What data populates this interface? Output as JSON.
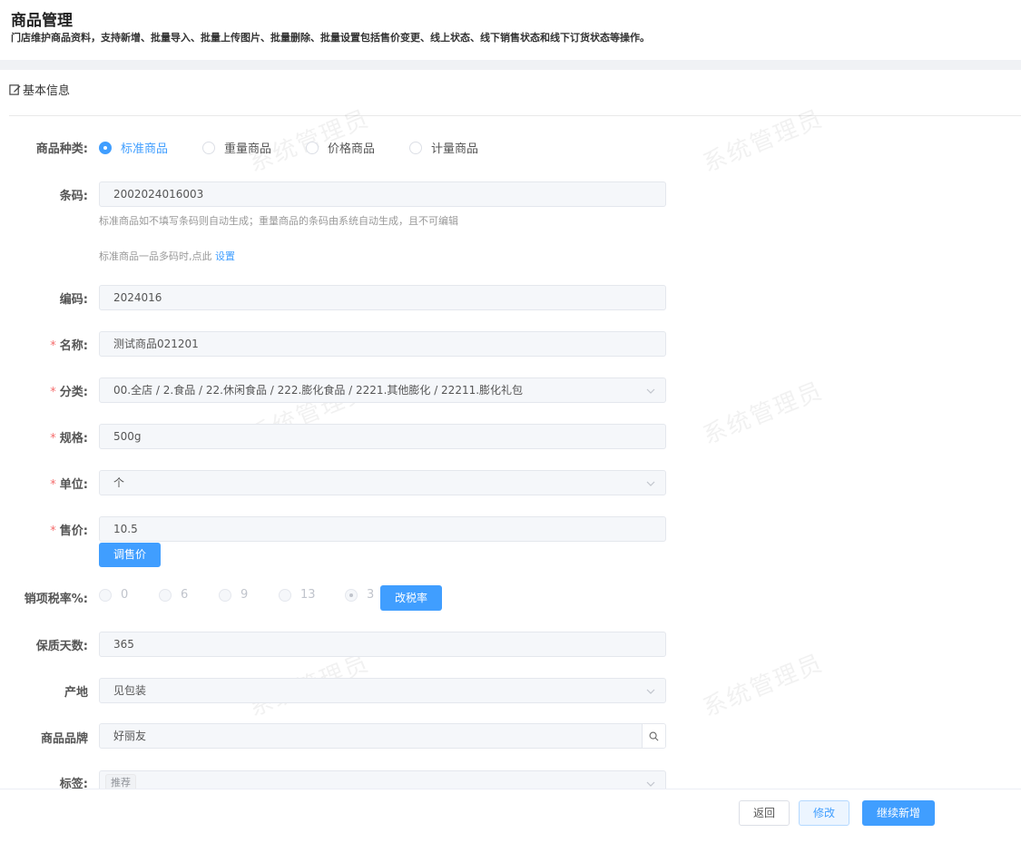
{
  "header": {
    "title": "商品管理",
    "description": "门店维护商品资料，支持新增、批量导入、批量上传图片、批量删除、批量设置包括售价变更、线上状态、线下销售状态和线下订货状态等操作。"
  },
  "section_title": "基本信息",
  "watermark": "系统管理员",
  "form": {
    "product_type": {
      "label": "商品种类:",
      "options": [
        "标准商品",
        "重量商品",
        "价格商品",
        "计量商品"
      ],
      "selected": "标准商品"
    },
    "barcode": {
      "label": "条码:",
      "value": "2002024016003",
      "hint1": "标准商品如不填写条码则自动生成；重量商品的条码由系统自动生成，且不可编辑",
      "hint2": "标准商品一品多码时,点此",
      "hint2_link": "设置"
    },
    "code": {
      "label": "编码:",
      "value": "2024016"
    },
    "name": {
      "label": "名称:",
      "value": "测试商品021201",
      "required": true
    },
    "category": {
      "label": "分类:",
      "value": "00.全店 / 2.食品 / 22.休闲食品 / 222.膨化食品 / 2221.其他膨化 / 22211.膨化礼包",
      "required": true
    },
    "spec": {
      "label": "规格:",
      "value": "500g",
      "required": true
    },
    "unit": {
      "label": "单位:",
      "value": "个",
      "required": true
    },
    "price": {
      "label": "售价:",
      "value": "10.5",
      "required": true,
      "adjust_button": "调售价"
    },
    "tax_rate": {
      "label": "销项税率%:",
      "options": [
        "0",
        "6",
        "9",
        "13",
        "3"
      ],
      "selected": "3",
      "change_button": "改税率"
    },
    "shelf_life": {
      "label": "保质天数:",
      "value": "365"
    },
    "origin": {
      "label": "产地",
      "value": "见包装"
    },
    "brand": {
      "label": "商品品牌",
      "value": "好丽友"
    },
    "tags": {
      "label": "标签:",
      "values": [
        "推荐"
      ]
    }
  },
  "footer": {
    "back_label": "返回",
    "edit_label": "修改",
    "continue_label": "继续新增"
  }
}
